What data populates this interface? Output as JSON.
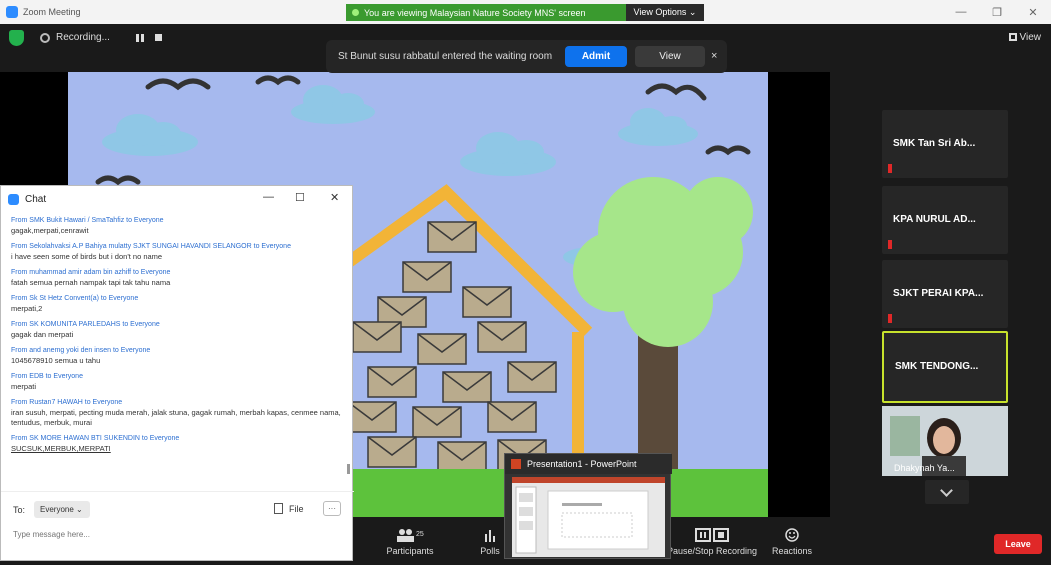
{
  "window": {
    "title": "Zoom Meeting",
    "share_banner": "You are viewing Malaysian Nature Society MNS' screen",
    "view_options": "View Options ⌄"
  },
  "topbar": {
    "recording_label": "Recording...",
    "view_label": "View"
  },
  "notification": {
    "message": "St Bunut susu rabbatul entered the waiting room",
    "admit_label": "Admit",
    "view_label": "View",
    "close_glyph": "×"
  },
  "chat": {
    "title": "Chat",
    "messages": [
      {
        "from": "From SMK Bukit Hawari / SmaTahfiz to Everyone",
        "text": "gagak,merpati,cenrawit"
      },
      {
        "from": "From Sekolahvaksi A.P Bahiya mulatty SJKT SUNGAI HAVANDI SELANGOR to Everyone",
        "text": "i have seen some of birds but i don't no name"
      },
      {
        "from": "From muhammad amir adam bin azhiff to Everyone",
        "text": "fatah semua pernah nampak tapi tak tahu nama"
      },
      {
        "from": "From Sk St Hetz Convent(a) to Everyone",
        "text": "merpati,2"
      },
      {
        "from": "From SK KOMUNITA PARLEDAHS to Everyone",
        "text": "gagak dan merpati"
      },
      {
        "from": "From and anemg yoki den insen to Everyone",
        "text": "1045678910 semua u tahu"
      },
      {
        "from": "From EDB to Everyone",
        "text": "merpati"
      },
      {
        "from": "From Rustan7 HAWAH to Everyone",
        "text": "iran susuh, merpati, pecting muda merah, jalak stuna, gagak rumah, merbah kapas, cenmee nama, tentudus, merbuk, murai"
      },
      {
        "from": "From SK MORE HAWAN BTI SUKENDIN to Everyone",
        "text": "SUCSUK,MERBUK,MERPATI"
      }
    ],
    "to_label": "To:",
    "to_value": "Everyone ⌄",
    "file_label": "File",
    "more_label": "···",
    "input_placeholder": "Type message here..."
  },
  "participants": [
    {
      "name": "SMK Tan Sri Ab..."
    },
    {
      "name": "KPA NURUL AD..."
    },
    {
      "name": "SJKT PERAI KPA..."
    },
    {
      "name": "SMK TENDONG..."
    }
  ],
  "video_participant": {
    "name": "Dhakynah Ya..."
  },
  "ppt": {
    "title": "Presentation1 - PowerPoint"
  },
  "toolbar": {
    "participants_label": "Participants",
    "participants_count": "257",
    "polls_label": "Polls",
    "recording_label": "Pause/Stop Recording",
    "reactions_label": "Reactions",
    "leave_label": "Leave"
  },
  "colors": {
    "accent": "#0e72ed",
    "leave": "#e02828",
    "active_speaker": "#c7e22c",
    "share_banner": "#3a9a2f"
  }
}
